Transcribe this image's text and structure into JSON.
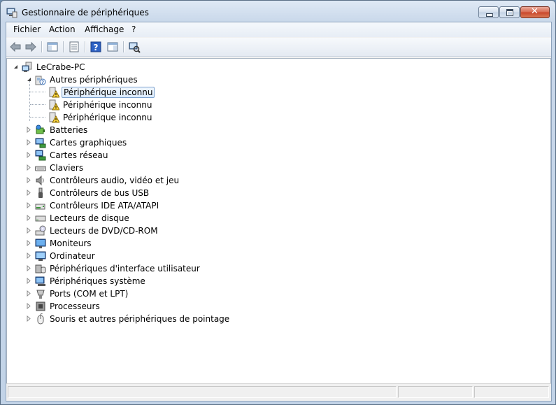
{
  "window": {
    "title": "Gestionnaire de périphériques"
  },
  "menu": {
    "items": [
      {
        "label": "Fichier"
      },
      {
        "label": "Action"
      },
      {
        "label": "Affichage"
      },
      {
        "label": "?"
      }
    ]
  },
  "toolbar": {
    "buttons": [
      "back-arrow-icon",
      "forward-arrow-icon",
      "show-hide-console-tree-icon",
      "properties-icon",
      "help-icon",
      "show-hide-action-pane-icon",
      "scan-hardware-changes-icon"
    ]
  },
  "tree": {
    "root": {
      "label": "LeCrabe-PC",
      "icon": "computer-icon"
    },
    "categories": [
      {
        "label": "Autres périphériques",
        "icon": "unknown-device-icon"
      },
      {
        "label": "Batteries",
        "icon": "battery-icon"
      },
      {
        "label": "Cartes graphiques",
        "icon": "display-adapter-icon"
      },
      {
        "label": "Cartes réseau",
        "icon": "network-adapter-icon"
      },
      {
        "label": "Claviers",
        "icon": "keyboard-icon"
      },
      {
        "label": "Contrôleurs audio, vidéo et jeu",
        "icon": "speaker-icon"
      },
      {
        "label": "Contrôleurs de bus USB",
        "icon": "usb-icon"
      },
      {
        "label": "Contrôleurs IDE ATA/ATAPI",
        "icon": "ide-controller-icon"
      },
      {
        "label": "Lecteurs de disque",
        "icon": "disk-drive-icon"
      },
      {
        "label": "Lecteurs de DVD/CD-ROM",
        "icon": "dvd-drive-icon"
      },
      {
        "label": "Moniteurs",
        "icon": "monitor-icon"
      },
      {
        "label": "Ordinateur",
        "icon": "computer-icon"
      },
      {
        "label": "Périphériques d'interface utilisateur",
        "icon": "hid-icon"
      },
      {
        "label": "Périphériques système",
        "icon": "system-device-icon"
      },
      {
        "label": "Ports (COM et LPT)",
        "icon": "port-icon"
      },
      {
        "label": "Processeurs",
        "icon": "processor-icon"
      },
      {
        "label": "Souris et autres périphériques de pointage",
        "icon": "mouse-icon"
      }
    ],
    "unknown_devices": [
      {
        "label": "Périphérique inconnu"
      },
      {
        "label": "Périphérique inconnu"
      },
      {
        "label": "Périphérique inconnu"
      }
    ]
  },
  "status": {
    "text": ""
  }
}
